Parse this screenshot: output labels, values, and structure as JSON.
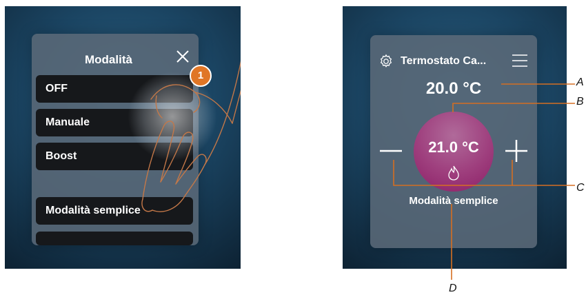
{
  "mode_menu": {
    "title": "Modalità",
    "options": [
      {
        "label": "OFF"
      },
      {
        "label": "Manuale"
      },
      {
        "label": "Boost"
      },
      {
        "label": "Modalità semplice"
      }
    ]
  },
  "step_badge": "1",
  "thermostat": {
    "title": "Termostato Ca...",
    "current_temperature": "20.0 °C",
    "setpoint_temperature": "21.0 °C",
    "mode": "Modalità semplice"
  },
  "callouts": {
    "a": "A",
    "b": "B",
    "c": "C",
    "d": "D"
  },
  "colors": {
    "accent": "#e07626",
    "setpoint_circle": "#9e3e7d",
    "background": "#1b4563",
    "option_background": "#16181b"
  },
  "icons": {
    "close": "close-icon",
    "settings": "gear-icon",
    "menu": "hamburger-menu-icon",
    "flame": "flame-icon",
    "minus": "minus-icon",
    "plus": "plus-icon"
  }
}
